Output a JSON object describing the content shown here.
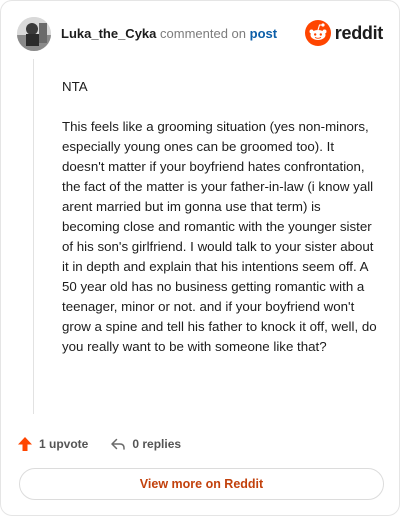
{
  "header": {
    "username": "Luka_the_Cyka",
    "commented_text": "commented on",
    "post_link": "post",
    "brand_word": "reddit"
  },
  "comment": {
    "paragraphs": [
      "NTA",
      "This feels like a grooming situation (yes non-minors, especially young ones can be groomed too). It doesn't matter if your boyfriend hates confrontation, the fact of the matter is your father-in-law (i know yall arent married but im gonna use that term) is becoming close and romantic with the younger sister of his son's girlfriend. I would talk to your sister about it in depth and explain that his intentions seem off. A 50 year old has no business getting romantic with a teenager, minor or not. and if your boyfriend won't grow a spine and tell his father to knock it off, well, do you really want to be with someone like that?"
    ]
  },
  "actions": {
    "upvote_label": "1 upvote",
    "replies_label": "0 replies"
  },
  "footer": {
    "view_more_label": "View more on Reddit"
  },
  "colors": {
    "brand_orange": "#ff4500",
    "upvote": "#ff4500",
    "link": "#0b5ea8",
    "view_more_text": "#c2410c"
  }
}
